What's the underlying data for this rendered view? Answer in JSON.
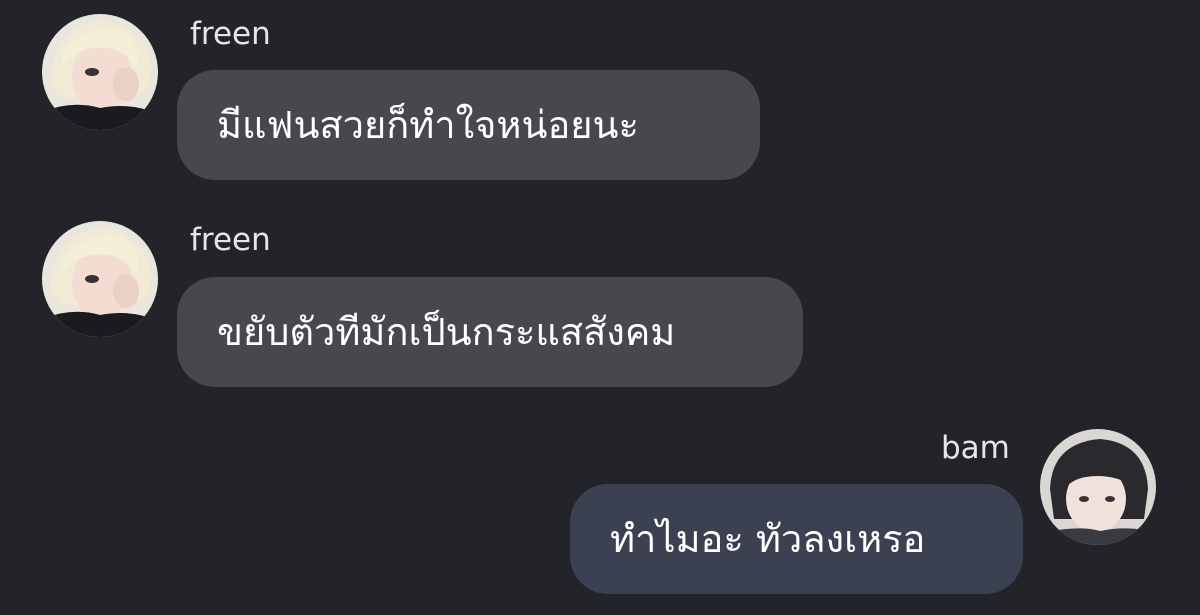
{
  "messages": [
    {
      "sender": "freen",
      "text": "มีแฟนสวยก็ทำใจหน่อยนะ",
      "direction": "incoming"
    },
    {
      "sender": "freen",
      "text": "ขยับตัวทีมักเป็นกระแสสังคม",
      "direction": "incoming"
    },
    {
      "sender": "bam",
      "text": "ทำไมอะ ทัวลงเหรอ",
      "direction": "outgoing"
    }
  ],
  "colors": {
    "background": "#232429",
    "incoming_bubble": "#47484e",
    "outgoing_bubble": "#3b4150",
    "name_text": "#e6e6e8",
    "message_text": "#ffffff"
  }
}
